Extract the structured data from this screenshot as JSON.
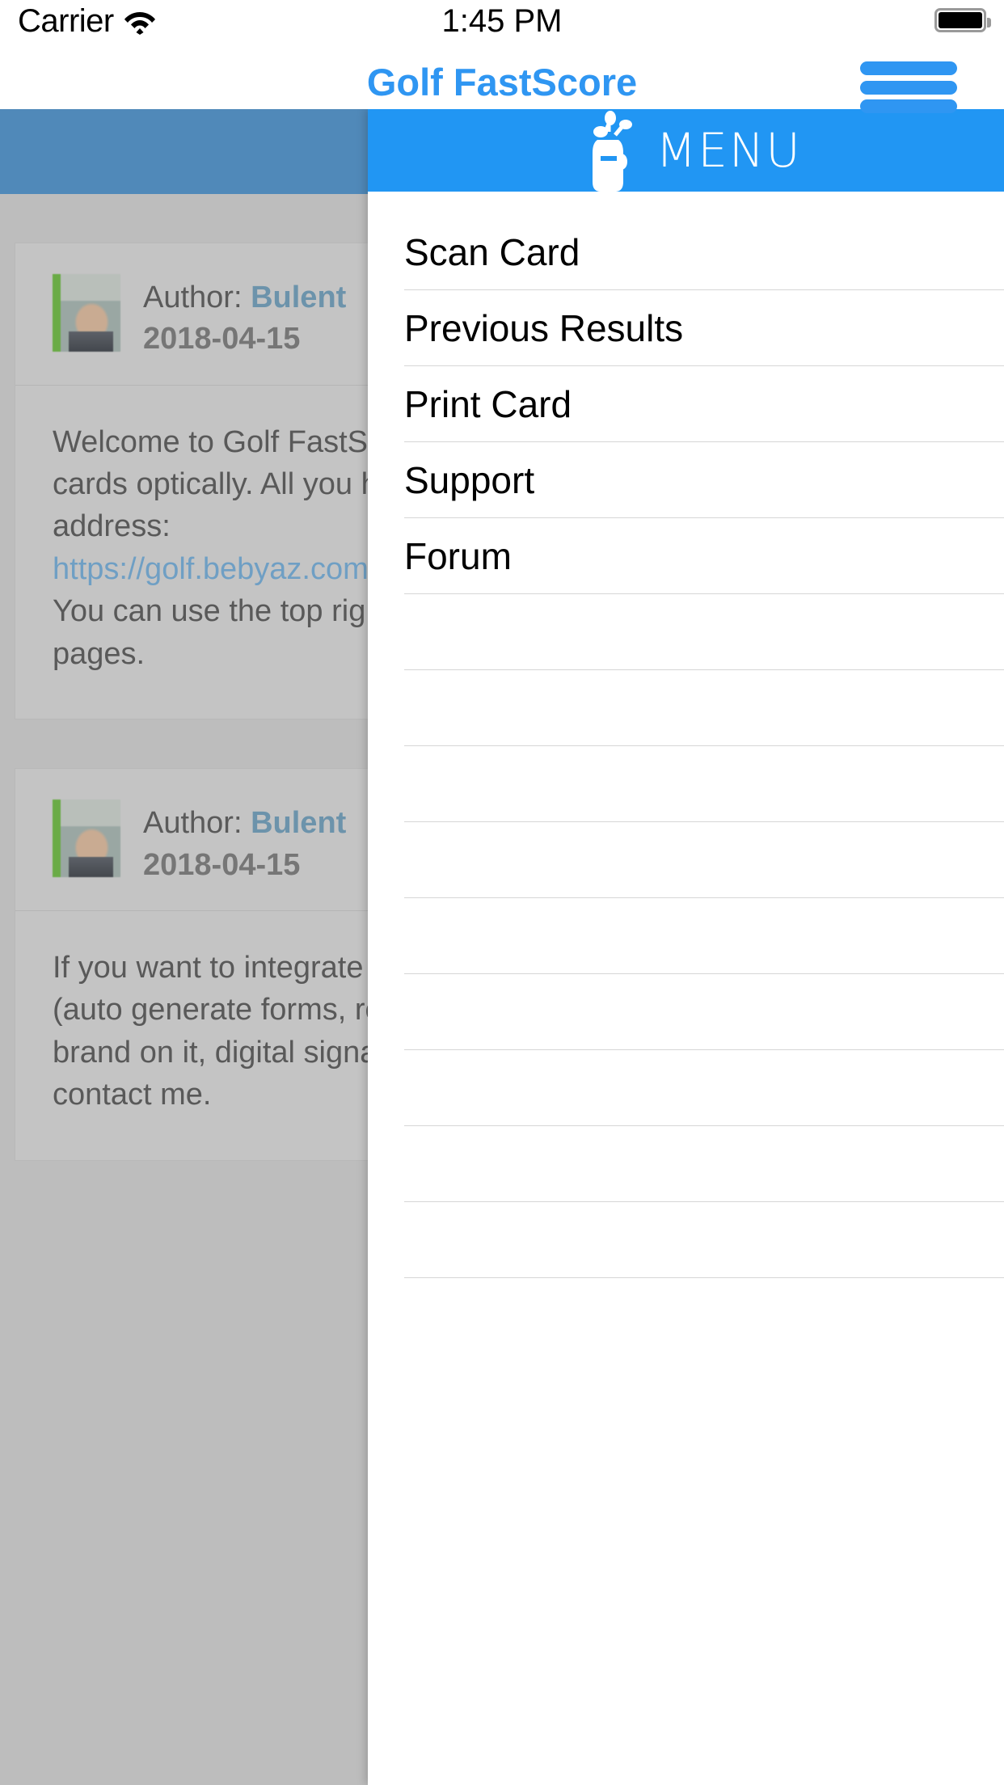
{
  "status_bar": {
    "carrier": "Carrier",
    "wifi_icon": "wifi-icon",
    "time": "1:45 PM",
    "battery_icon": "battery-full-icon"
  },
  "nav_bar": {
    "title": "Golf FastScore",
    "title_color": "#2f96f2",
    "menu_button_icon": "hamburger-menu-icon"
  },
  "menu_panel": {
    "header": {
      "title": "MENU",
      "icon": "golf-bag-icon",
      "background_color": "#2196f3"
    },
    "items": [
      {
        "label": "Scan Card"
      },
      {
        "label": "Previous Results"
      },
      {
        "label": "Print Card"
      },
      {
        "label": "Support"
      },
      {
        "label": "Forum"
      },
      {
        "label": ""
      },
      {
        "label": ""
      },
      {
        "label": ""
      },
      {
        "label": ""
      },
      {
        "label": ""
      },
      {
        "label": ""
      },
      {
        "label": ""
      },
      {
        "label": ""
      },
      {
        "label": ""
      }
    ]
  },
  "content": {
    "hero_band_color": "#5089b9",
    "posts": [
      {
        "author_label": "Author:",
        "author_name": "Bulent",
        "date": "2018-04-15",
        "avatar_icon": "author-avatar",
        "body_lines": [
          "Welcome to Golf FastScore. This",
          "cards optically. All you have to do",
          "address:"
        ],
        "link": "https://golf.bebyaz.com",
        "body_lines_after": [
          "You can use the top right menu b",
          "pages."
        ]
      },
      {
        "author_label": "Author:",
        "author_name": "Bulent",
        "date": "2018-04-15",
        "avatar_icon": "author-avatar",
        "body_lines": [
          "If you want to integrate this syste",
          "(auto generate forms, results ins",
          "brand on it, digital signage, ...etc",
          "contact me."
        ],
        "link": "",
        "body_lines_after": []
      }
    ]
  }
}
